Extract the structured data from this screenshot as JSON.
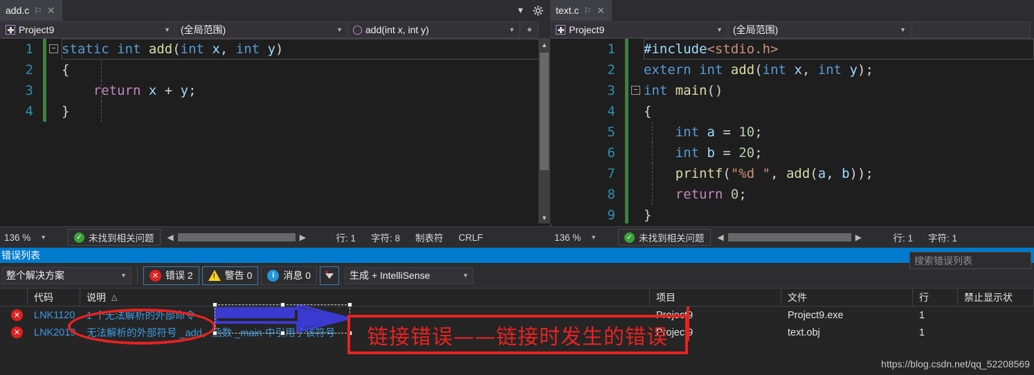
{
  "editors": [
    {
      "tab": {
        "title": "add.c",
        "pin": "⚐",
        "close": "✕"
      },
      "nav": {
        "project": "Project9",
        "scope": "(全局范围)",
        "member": "add(int x, int y)"
      },
      "lines": [
        "1",
        "2",
        "3",
        "4"
      ],
      "status": {
        "zoom": "136 %",
        "issues": "未找到相关问题",
        "line": "行: 1",
        "col": "字符: 8",
        "tabs": "制表符",
        "eol": "CRLF"
      }
    },
    {
      "tab": {
        "title": "text.c",
        "pin": "⚐",
        "close": "✕"
      },
      "nav": {
        "project": "Project9",
        "scope": "(全局范围)",
        "member": ""
      },
      "lines": [
        "1",
        "2",
        "3",
        "4",
        "5",
        "6",
        "7",
        "8",
        "9"
      ],
      "status": {
        "zoom": "136 %",
        "issues": "未找到相关问题",
        "line": "行: 1",
        "col": "字符: 1"
      }
    }
  ],
  "code_left": [
    "static int add(int x, int y)",
    "{",
    "    return x + y;",
    "}"
  ],
  "code_right": [
    "#include<stdio.h>",
    "extern int add(int x, int y);",
    "int main()",
    "{",
    "    int a = 10;",
    "    int b = 20;",
    "    printf(\"%d \", add(a, b));",
    "    return 0;",
    "}"
  ],
  "error_panel": {
    "title": "错误列表",
    "scope_filter": "整个解决方案",
    "errors_label": "错误 2",
    "warnings_label": "警告 0",
    "messages_label": "消息 0",
    "build_filter": "生成 + IntelliSense",
    "search_placeholder": "搜索错误列表",
    "columns": {
      "code": "代码",
      "description": "说明",
      "project": "项目",
      "file": "文件",
      "line": "行",
      "suppress": "禁止显示状"
    },
    "sort_glyph": "△",
    "rows": [
      {
        "code": "LNK1120",
        "description": "1 个无法解析的外部命令",
        "project": "Project9",
        "file": "Project9.exe",
        "line": "1",
        "suppress": ""
      },
      {
        "code": "LNK2019",
        "description": "无法解析的外部符号 _add，函数 _main 中引用了该符号",
        "project": "Project9",
        "file": "text.obj",
        "line": "1",
        "suppress": ""
      }
    ]
  },
  "annotation": {
    "red_box_text": "链接错误——链接时发生的错误"
  },
  "watermark": "https://blog.csdn.net/qq_52208569",
  "colors": {
    "accent": "#007acc",
    "error_red": "#e8221f",
    "annotation_blue": "#3a3ad0"
  }
}
